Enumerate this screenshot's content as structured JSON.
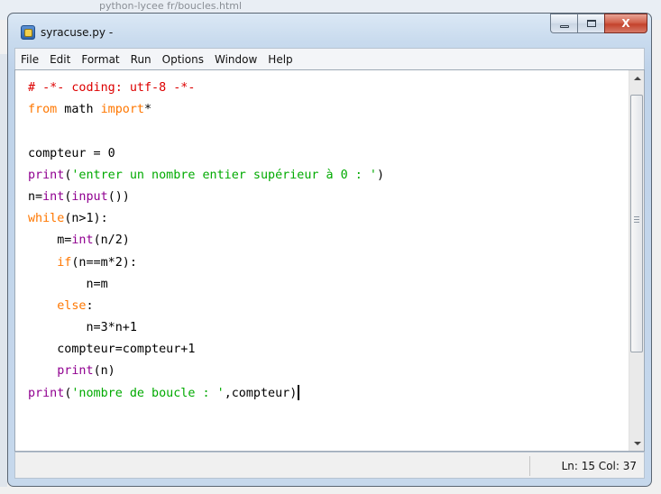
{
  "background": {
    "text": "python-lycee fr/boucles.html"
  },
  "window": {
    "title": "syracuse.py -",
    "buttons": {
      "minimize": "minimize",
      "maximize": "maximize",
      "close": "X"
    }
  },
  "menu": [
    "File",
    "Edit",
    "Format",
    "Run",
    "Options",
    "Window",
    "Help"
  ],
  "editor": {
    "lines": [
      [
        [
          "cm",
          "# -*- coding: utf-8 -*-"
        ]
      ],
      [
        [
          "kw",
          "from"
        ],
        [
          "",
          " math "
        ],
        [
          "kw",
          "import"
        ],
        [
          "",
          "*"
        ]
      ],
      [],
      [
        [
          "",
          "compteur = 0"
        ]
      ],
      [
        [
          "bi",
          "print"
        ],
        [
          "",
          "("
        ],
        [
          "st",
          "'entrer un nombre entier supérieur à 0 : '"
        ],
        [
          "",
          ")"
        ]
      ],
      [
        [
          "",
          "n="
        ],
        [
          "bi",
          "int"
        ],
        [
          "",
          "("
        ],
        [
          "bi",
          "input"
        ],
        [
          "",
          "())"
        ]
      ],
      [
        [
          "kw",
          "while"
        ],
        [
          "",
          "(n>1):"
        ]
      ],
      [
        [
          "",
          "    m="
        ],
        [
          "bi",
          "int"
        ],
        [
          "",
          "(n/2)"
        ]
      ],
      [
        [
          "",
          "    "
        ],
        [
          "kw",
          "if"
        ],
        [
          "",
          "(n==m*2):"
        ]
      ],
      [
        [
          "",
          "        n=m"
        ]
      ],
      [
        [
          "",
          "    "
        ],
        [
          "kw",
          "else"
        ],
        [
          "",
          ":"
        ]
      ],
      [
        [
          "",
          "        n=3*n+1"
        ]
      ],
      [
        [
          "",
          "    compteur=compteur+1"
        ]
      ],
      [
        [
          "",
          "    "
        ],
        [
          "bi",
          "print"
        ],
        [
          "",
          "(n)"
        ]
      ],
      [
        [
          "bi",
          "print"
        ],
        [
          "",
          "("
        ],
        [
          "st",
          "'nombre de boucle : '"
        ],
        [
          "",
          ",compteur)"
        ]
      ]
    ],
    "syntax_colors": {
      "keyword": "#ff7700",
      "comment": "#dd0000",
      "builtin": "#900090",
      "string": "#00aa00"
    }
  },
  "status": {
    "position": "Ln: 15   Col: 37"
  }
}
